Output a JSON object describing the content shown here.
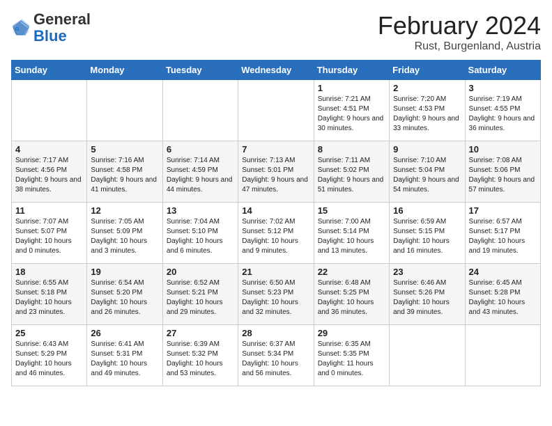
{
  "logo": {
    "general": "General",
    "blue": "Blue"
  },
  "title": "February 2024",
  "subtitle": "Rust, Burgenland, Austria",
  "days_of_week": [
    "Sunday",
    "Monday",
    "Tuesday",
    "Wednesday",
    "Thursday",
    "Friday",
    "Saturday"
  ],
  "weeks": [
    [
      {
        "day": "",
        "info": ""
      },
      {
        "day": "",
        "info": ""
      },
      {
        "day": "",
        "info": ""
      },
      {
        "day": "",
        "info": ""
      },
      {
        "day": "1",
        "info": "Sunrise: 7:21 AM\nSunset: 4:51 PM\nDaylight: 9 hours\nand 30 minutes."
      },
      {
        "day": "2",
        "info": "Sunrise: 7:20 AM\nSunset: 4:53 PM\nDaylight: 9 hours\nand 33 minutes."
      },
      {
        "day": "3",
        "info": "Sunrise: 7:19 AM\nSunset: 4:55 PM\nDaylight: 9 hours\nand 36 minutes."
      }
    ],
    [
      {
        "day": "4",
        "info": "Sunrise: 7:17 AM\nSunset: 4:56 PM\nDaylight: 9 hours\nand 38 minutes."
      },
      {
        "day": "5",
        "info": "Sunrise: 7:16 AM\nSunset: 4:58 PM\nDaylight: 9 hours\nand 41 minutes."
      },
      {
        "day": "6",
        "info": "Sunrise: 7:14 AM\nSunset: 4:59 PM\nDaylight: 9 hours\nand 44 minutes."
      },
      {
        "day": "7",
        "info": "Sunrise: 7:13 AM\nSunset: 5:01 PM\nDaylight: 9 hours\nand 47 minutes."
      },
      {
        "day": "8",
        "info": "Sunrise: 7:11 AM\nSunset: 5:02 PM\nDaylight: 9 hours\nand 51 minutes."
      },
      {
        "day": "9",
        "info": "Sunrise: 7:10 AM\nSunset: 5:04 PM\nDaylight: 9 hours\nand 54 minutes."
      },
      {
        "day": "10",
        "info": "Sunrise: 7:08 AM\nSunset: 5:06 PM\nDaylight: 9 hours\nand 57 minutes."
      }
    ],
    [
      {
        "day": "11",
        "info": "Sunrise: 7:07 AM\nSunset: 5:07 PM\nDaylight: 10 hours\nand 0 minutes."
      },
      {
        "day": "12",
        "info": "Sunrise: 7:05 AM\nSunset: 5:09 PM\nDaylight: 10 hours\nand 3 minutes."
      },
      {
        "day": "13",
        "info": "Sunrise: 7:04 AM\nSunset: 5:10 PM\nDaylight: 10 hours\nand 6 minutes."
      },
      {
        "day": "14",
        "info": "Sunrise: 7:02 AM\nSunset: 5:12 PM\nDaylight: 10 hours\nand 9 minutes."
      },
      {
        "day": "15",
        "info": "Sunrise: 7:00 AM\nSunset: 5:14 PM\nDaylight: 10 hours\nand 13 minutes."
      },
      {
        "day": "16",
        "info": "Sunrise: 6:59 AM\nSunset: 5:15 PM\nDaylight: 10 hours\nand 16 minutes."
      },
      {
        "day": "17",
        "info": "Sunrise: 6:57 AM\nSunset: 5:17 PM\nDaylight: 10 hours\nand 19 minutes."
      }
    ],
    [
      {
        "day": "18",
        "info": "Sunrise: 6:55 AM\nSunset: 5:18 PM\nDaylight: 10 hours\nand 23 minutes."
      },
      {
        "day": "19",
        "info": "Sunrise: 6:54 AM\nSunset: 5:20 PM\nDaylight: 10 hours\nand 26 minutes."
      },
      {
        "day": "20",
        "info": "Sunrise: 6:52 AM\nSunset: 5:21 PM\nDaylight: 10 hours\nand 29 minutes."
      },
      {
        "day": "21",
        "info": "Sunrise: 6:50 AM\nSunset: 5:23 PM\nDaylight: 10 hours\nand 32 minutes."
      },
      {
        "day": "22",
        "info": "Sunrise: 6:48 AM\nSunset: 5:25 PM\nDaylight: 10 hours\nand 36 minutes."
      },
      {
        "day": "23",
        "info": "Sunrise: 6:46 AM\nSunset: 5:26 PM\nDaylight: 10 hours\nand 39 minutes."
      },
      {
        "day": "24",
        "info": "Sunrise: 6:45 AM\nSunset: 5:28 PM\nDaylight: 10 hours\nand 43 minutes."
      }
    ],
    [
      {
        "day": "25",
        "info": "Sunrise: 6:43 AM\nSunset: 5:29 PM\nDaylight: 10 hours\nand 46 minutes."
      },
      {
        "day": "26",
        "info": "Sunrise: 6:41 AM\nSunset: 5:31 PM\nDaylight: 10 hours\nand 49 minutes."
      },
      {
        "day": "27",
        "info": "Sunrise: 6:39 AM\nSunset: 5:32 PM\nDaylight: 10 hours\nand 53 minutes."
      },
      {
        "day": "28",
        "info": "Sunrise: 6:37 AM\nSunset: 5:34 PM\nDaylight: 10 hours\nand 56 minutes."
      },
      {
        "day": "29",
        "info": "Sunrise: 6:35 AM\nSunset: 5:35 PM\nDaylight: 11 hours\nand 0 minutes."
      },
      {
        "day": "",
        "info": ""
      },
      {
        "day": "",
        "info": ""
      }
    ]
  ]
}
